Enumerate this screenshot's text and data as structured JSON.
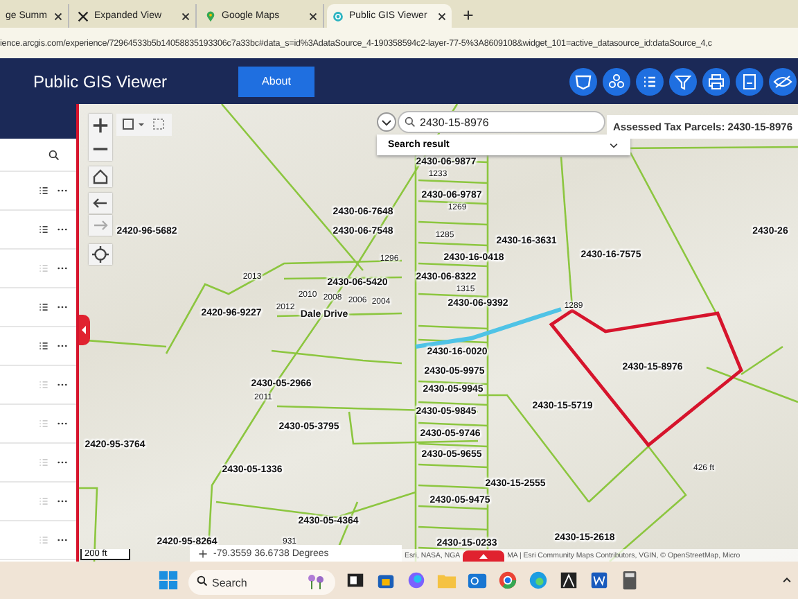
{
  "browser": {
    "tabs": [
      {
        "title": "ge Summ",
        "kind": "doc",
        "selected": false
      },
      {
        "title": "Expanded View",
        "kind": "x",
        "selected": false
      },
      {
        "title": "Google Maps",
        "kind": "maps",
        "selected": false
      },
      {
        "title": "Public GIS Viewer",
        "kind": "gis",
        "selected": true
      }
    ],
    "url": "ience.arcgis.com/experience/72964533b5b14058835193306c7a33bc#data_s=id%3AdataSource_4-190358594c2-layer-77-5%3A8609108&widget_101=active_datasource_id:dataSource_4,c"
  },
  "app": {
    "title": "Public GIS Viewer",
    "about": "About",
    "tools": [
      {
        "kind": "basemap"
      },
      {
        "kind": "people"
      },
      {
        "kind": "list"
      },
      {
        "kind": "filter"
      },
      {
        "kind": "print"
      },
      {
        "kind": "save"
      },
      {
        "kind": "hide"
      }
    ]
  },
  "layer_panel": {
    "rows": [
      {
        "enabled": true
      },
      {
        "enabled": true
      },
      {
        "enabled": false
      },
      {
        "enabled": true
      },
      {
        "enabled": true
      },
      {
        "enabled": false
      },
      {
        "enabled": false
      },
      {
        "enabled": false
      },
      {
        "enabled": false
      },
      {
        "enabled": false
      }
    ]
  },
  "map": {
    "search": {
      "value": "2430-15-8976"
    },
    "search_result": "Search result",
    "info_title": "Assessed Tax Parcels: 2430-15-8976",
    "labels": [
      {
        "text": "2420-96-5682",
        "kind": "parcel"
      },
      {
        "text": "2420-96-9227",
        "kind": "parcel"
      },
      {
        "text": "2430-06-9877",
        "kind": "parcel"
      },
      {
        "text": "1233",
        "kind": "lot"
      },
      {
        "text": "2430-06-9787",
        "kind": "parcel"
      },
      {
        "text": "1269",
        "kind": "lot"
      },
      {
        "text": "2430-06-7648",
        "kind": "parcel"
      },
      {
        "text": "2430-06-7548",
        "kind": "parcel"
      },
      {
        "text": "1285",
        "kind": "lot"
      },
      {
        "text": "1296",
        "kind": "lot"
      },
      {
        "text": "2430-16-3631",
        "kind": "parcel"
      },
      {
        "text": "2430-16-0418",
        "kind": "parcel"
      },
      {
        "text": "2430-16-7575",
        "kind": "parcel"
      },
      {
        "text": "2013",
        "kind": "lot"
      },
      {
        "text": "2430-06-5420",
        "kind": "parcel"
      },
      {
        "text": "2010",
        "kind": "lot"
      },
      {
        "text": "2008",
        "kind": "lot"
      },
      {
        "text": "2006",
        "kind": "lot"
      },
      {
        "text": "2004",
        "kind": "lot"
      },
      {
        "text": "2012",
        "kind": "lot"
      },
      {
        "text": "Dale Drive",
        "kind": "street"
      },
      {
        "text": "2430-06-8322",
        "kind": "parcel"
      },
      {
        "text": "1315",
        "kind": "lot"
      },
      {
        "text": "2430-06-9392",
        "kind": "parcel"
      },
      {
        "text": "1289",
        "kind": "lot"
      },
      {
        "text": "2430-16-0020",
        "kind": "parcel"
      },
      {
        "text": "2430-05-2966",
        "kind": "parcel"
      },
      {
        "text": "2011",
        "kind": "lot"
      },
      {
        "text": "2430-05-9975",
        "kind": "parcel"
      },
      {
        "text": "2430-15-8976",
        "kind": "parcel"
      },
      {
        "text": "2430-05-9945",
        "kind": "parcel"
      },
      {
        "text": "2430-15-5719",
        "kind": "parcel"
      },
      {
        "text": "2430-05-9845",
        "kind": "parcel"
      },
      {
        "text": "2430-05-3795",
        "kind": "parcel"
      },
      {
        "text": "2430-05-9746",
        "kind": "parcel"
      },
      {
        "text": "2420-95-3764",
        "kind": "parcel"
      },
      {
        "text": "2430-05-9655",
        "kind": "parcel"
      },
      {
        "text": "2430-05-1336",
        "kind": "parcel"
      },
      {
        "text": "2430-15-2555",
        "kind": "parcel"
      },
      {
        "text": "2430-05-9475",
        "kind": "parcel"
      },
      {
        "text": "2430-05-4364",
        "kind": "parcel"
      },
      {
        "text": "2420-95-8264",
        "kind": "parcel"
      },
      {
        "text": "931",
        "kind": "lot"
      },
      {
        "text": "2430-15-0233",
        "kind": "parcel"
      },
      {
        "text": "2430-15-2618",
        "kind": "parcel"
      },
      {
        "text": "2430-26",
        "kind": "parcel"
      },
      {
        "text": "426 ft",
        "kind": "lot"
      }
    ],
    "scale": "200 ft",
    "coordinates": "-79.3559 36.6738 Degrees",
    "attribution": [
      "Esri, NASA, NGA",
      "MA | Esri Community Maps Contributors, VGIN, © OpenStreetMap, Micro"
    ]
  },
  "taskbar": {
    "search_placeholder": "Search"
  }
}
